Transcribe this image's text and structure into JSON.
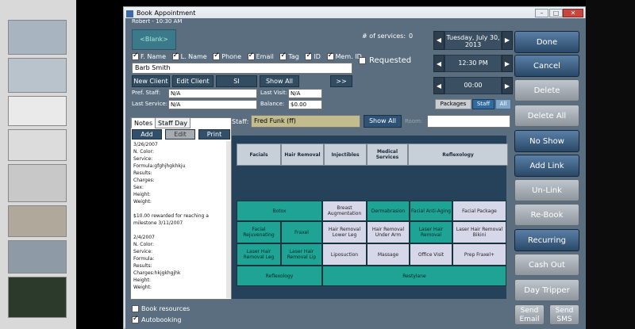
{
  "window": {
    "title": "Book Appointment",
    "user_time": "Robert - 10:30 AM"
  },
  "client": {
    "blank_button": "<Blank>",
    "name_value": "Barb Smith",
    "checkbox_filters": [
      {
        "label": "F. Name",
        "checked": true
      },
      {
        "label": "L. Name",
        "checked": true
      },
      {
        "label": "Phone",
        "checked": true
      },
      {
        "label": "Email",
        "checked": true
      },
      {
        "label": "Tag",
        "checked": true
      },
      {
        "label": "ID",
        "checked": true
      },
      {
        "label": "Mem. ID",
        "checked": true
      }
    ],
    "buttons": {
      "new_client": "New Client",
      "edit_client": "Edit Client",
      "si": "SI",
      "show_all": "Show All",
      "next": ">>"
    },
    "pref_staff_label": "Pref. Staff:",
    "pref_staff_value": "N/A",
    "last_visit_label": "Last Visit:",
    "last_visit_value": "N/A",
    "last_service_label": "Last Service:",
    "last_service_value": "N/A",
    "balance_label": "Balance:",
    "balance_value": "$0.00"
  },
  "services": {
    "count_label": "# of services:",
    "count_value": "0",
    "requested_label": "Requested"
  },
  "datetime": {
    "date": "Tuesday, July 30, 2013",
    "time": "12:30 PM",
    "duration": "00:00"
  },
  "toggles": {
    "packages": "Packages",
    "staff": "Staff",
    "all": "All"
  },
  "staff": {
    "label": "Staff:",
    "value": "Fred Funk (ff)",
    "show_all": "Show All",
    "room_label": "Room:",
    "room_value": ""
  },
  "notes": {
    "tabs": [
      "Notes",
      "Staff Day"
    ],
    "add": "Add",
    "edit": "Edit",
    "print": "Print",
    "text": "3/26/2007\nN. Color:\nService:\nFormula:gfghjhgkhkju\nResults:\nCharges:\nSex:\nHeight:\nWeight:\n\n$10.00 rewarded for reaching a milestone 3/11/2007\n\n2/4/2007\nN. Color:\nService:\nFormula:\nResults:\nCharges:hkjgkhgjhk\nHeight:\nWeight:"
  },
  "categories": [
    "Facials",
    "Hair Removal",
    "Injectibles",
    "Medical Services",
    "Reflexology"
  ],
  "service_grid": {
    "botox": "Botox",
    "breast_aug": "Breast Augmentation",
    "dermabrasion": "Dermabrasion",
    "facial_anti_aging": "Facial Anti-Aging",
    "facial_package": "Facial Package",
    "facial_rejuvenating": "Facial Rejuvenating",
    "fraxel": "Fraxel",
    "hr_lower_leg": "Hair Removal Lower Leg",
    "hr_under_arm": "Hair Removal Under Arm",
    "laser_hr_removal": "Laser Hair Removal",
    "laser_hr_bikini": "Laser Hair Removal Bikini",
    "laser_hr_leg": "Laser Hair Removal Leg",
    "laser_hr_lip": "Laser Hair Removal Lip",
    "liposuction": "Liposuction",
    "massage": "Massage",
    "office_visit": "Office Visit",
    "prep_fraxel": "Prep Fraxel+",
    "reflexology": "Reflexology",
    "restylane": "Restylane"
  },
  "bottom": {
    "book_resources": "Book resources",
    "book_resources_checked": false,
    "autobooking": "Autobooking",
    "autobooking_checked": true
  },
  "actions": {
    "done": "Done",
    "cancel": "Cancel",
    "delete": "Delete",
    "delete_all": "Delete All",
    "no_show": "No Show",
    "add_link": "Add Link",
    "un_link": "Un-Link",
    "re_book": "Re-Book",
    "recurring": "Recurring",
    "cash_out": "Cash Out",
    "day_tripper": "Day Tripper",
    "send_email": "Send Email",
    "send_sms": "Send SMS"
  }
}
